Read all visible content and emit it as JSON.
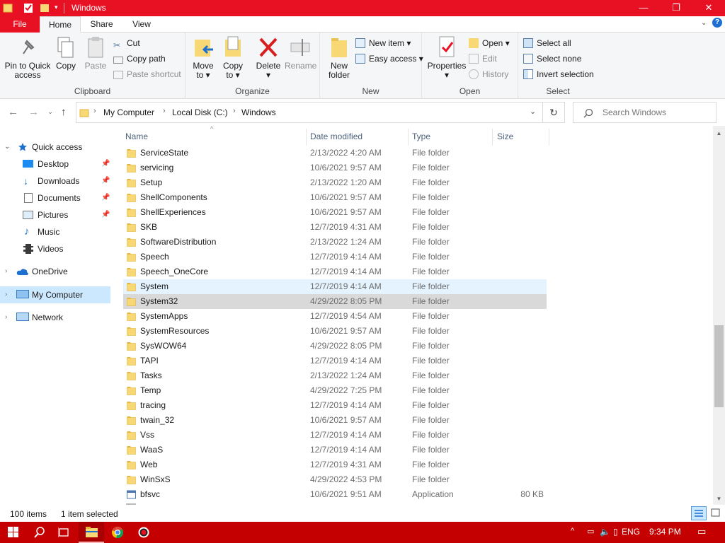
{
  "window": {
    "title": "Windows"
  },
  "titlebar_controls": {
    "minimize": "—",
    "maximize": "❐",
    "close": "✕"
  },
  "tabs": [
    "File",
    "Home",
    "Share",
    "View"
  ],
  "ribbon": {
    "clipboard": {
      "label": "Clipboard",
      "pin": [
        "Pin to Quick",
        "access"
      ],
      "copy": "Copy",
      "paste": "Paste",
      "cut": "Cut",
      "copy_path": "Copy path",
      "paste_shortcut": "Paste shortcut"
    },
    "organize": {
      "label": "Organize",
      "move_to": [
        "Move",
        "to ▾"
      ],
      "copy_to": [
        "Copy",
        "to ▾"
      ],
      "delete": [
        "Delete",
        "▾"
      ],
      "rename": "Rename"
    },
    "new": {
      "label": "New",
      "new_folder": [
        "New",
        "folder"
      ],
      "new_item": "New item ▾",
      "easy_access": "Easy access ▾"
    },
    "open": {
      "label": "Open",
      "properties": [
        "Properties",
        "▾"
      ],
      "open": "Open ▾",
      "edit": "Edit",
      "history": "History"
    },
    "select": {
      "label": "Select",
      "select_all": "Select all",
      "select_none": "Select none",
      "invert_selection": "Invert selection"
    }
  },
  "address": {
    "breadcrumbs": [
      "My Computer",
      "Local Disk (C:)",
      "Windows"
    ],
    "search_placeholder": "Search Windows"
  },
  "navpane": {
    "quick_access": "Quick access",
    "quick_items": [
      {
        "label": "Desktop",
        "pinned": true
      },
      {
        "label": "Downloads",
        "pinned": true
      },
      {
        "label": "Documents",
        "pinned": true
      },
      {
        "label": "Pictures",
        "pinned": true
      },
      {
        "label": "Music",
        "pinned": false
      },
      {
        "label": "Videos",
        "pinned": false
      }
    ],
    "onedrive": "OneDrive",
    "my_computer": "My Computer",
    "network": "Network"
  },
  "columns": {
    "name": "Name",
    "date": "Date modified",
    "type": "Type",
    "size": "Size"
  },
  "files": [
    {
      "name": "ServiceState",
      "date": "2/13/2022 4:20 AM",
      "type": "File folder",
      "size": "",
      "state": ""
    },
    {
      "name": "servicing",
      "date": "10/6/2021 9:57 AM",
      "type": "File folder",
      "size": "",
      "state": ""
    },
    {
      "name": "Setup",
      "date": "2/13/2022 1:20 AM",
      "type": "File folder",
      "size": "",
      "state": ""
    },
    {
      "name": "ShellComponents",
      "date": "10/6/2021 9:57 AM",
      "type": "File folder",
      "size": "",
      "state": ""
    },
    {
      "name": "ShellExperiences",
      "date": "10/6/2021 9:57 AM",
      "type": "File folder",
      "size": "",
      "state": ""
    },
    {
      "name": "SKB",
      "date": "12/7/2019 4:31 AM",
      "type": "File folder",
      "size": "",
      "state": ""
    },
    {
      "name": "SoftwareDistribution",
      "date": "2/13/2022 1:24 AM",
      "type": "File folder",
      "size": "",
      "state": ""
    },
    {
      "name": "Speech",
      "date": "12/7/2019 4:14 AM",
      "type": "File folder",
      "size": "",
      "state": ""
    },
    {
      "name": "Speech_OneCore",
      "date": "12/7/2019 4:14 AM",
      "type": "File folder",
      "size": "",
      "state": ""
    },
    {
      "name": "System",
      "date": "12/7/2019 4:14 AM",
      "type": "File folder",
      "size": "",
      "state": "hover"
    },
    {
      "name": "System32",
      "date": "4/29/2022 8:05 PM",
      "type": "File folder",
      "size": "",
      "state": "sel"
    },
    {
      "name": "SystemApps",
      "date": "12/7/2019 4:54 AM",
      "type": "File folder",
      "size": "",
      "state": ""
    },
    {
      "name": "SystemResources",
      "date": "10/6/2021 9:57 AM",
      "type": "File folder",
      "size": "",
      "state": ""
    },
    {
      "name": "SysWOW64",
      "date": "4/29/2022 8:05 PM",
      "type": "File folder",
      "size": "",
      "state": ""
    },
    {
      "name": "TAPI",
      "date": "12/7/2019 4:14 AM",
      "type": "File folder",
      "size": "",
      "state": ""
    },
    {
      "name": "Tasks",
      "date": "2/13/2022 1:24 AM",
      "type": "File folder",
      "size": "",
      "state": ""
    },
    {
      "name": "Temp",
      "date": "4/29/2022 7:25 PM",
      "type": "File folder",
      "size": "",
      "state": ""
    },
    {
      "name": "tracing",
      "date": "12/7/2019 4:14 AM",
      "type": "File folder",
      "size": "",
      "state": ""
    },
    {
      "name": "twain_32",
      "date": "10/6/2021 9:57 AM",
      "type": "File folder",
      "size": "",
      "state": ""
    },
    {
      "name": "Vss",
      "date": "12/7/2019 4:14 AM",
      "type": "File folder",
      "size": "",
      "state": ""
    },
    {
      "name": "WaaS",
      "date": "12/7/2019 4:14 AM",
      "type": "File folder",
      "size": "",
      "state": ""
    },
    {
      "name": "Web",
      "date": "12/7/2019 4:31 AM",
      "type": "File folder",
      "size": "",
      "state": ""
    },
    {
      "name": "WinSxS",
      "date": "4/29/2022 4:53 PM",
      "type": "File folder",
      "size": "",
      "state": ""
    },
    {
      "name": "bfsvc",
      "date": "10/6/2021 9:51 AM",
      "type": "Application",
      "size": "80 KB",
      "state": "",
      "icon": "app"
    }
  ],
  "status": {
    "count": "100 items",
    "selected": "1 item selected"
  },
  "taskbar": {
    "lang": "ENG",
    "time": "9:34 PM"
  },
  "colors": {
    "accent": "#e81123",
    "taskbar": "#c40000",
    "folder": "#f8d775",
    "selection": "#cce8ff"
  }
}
